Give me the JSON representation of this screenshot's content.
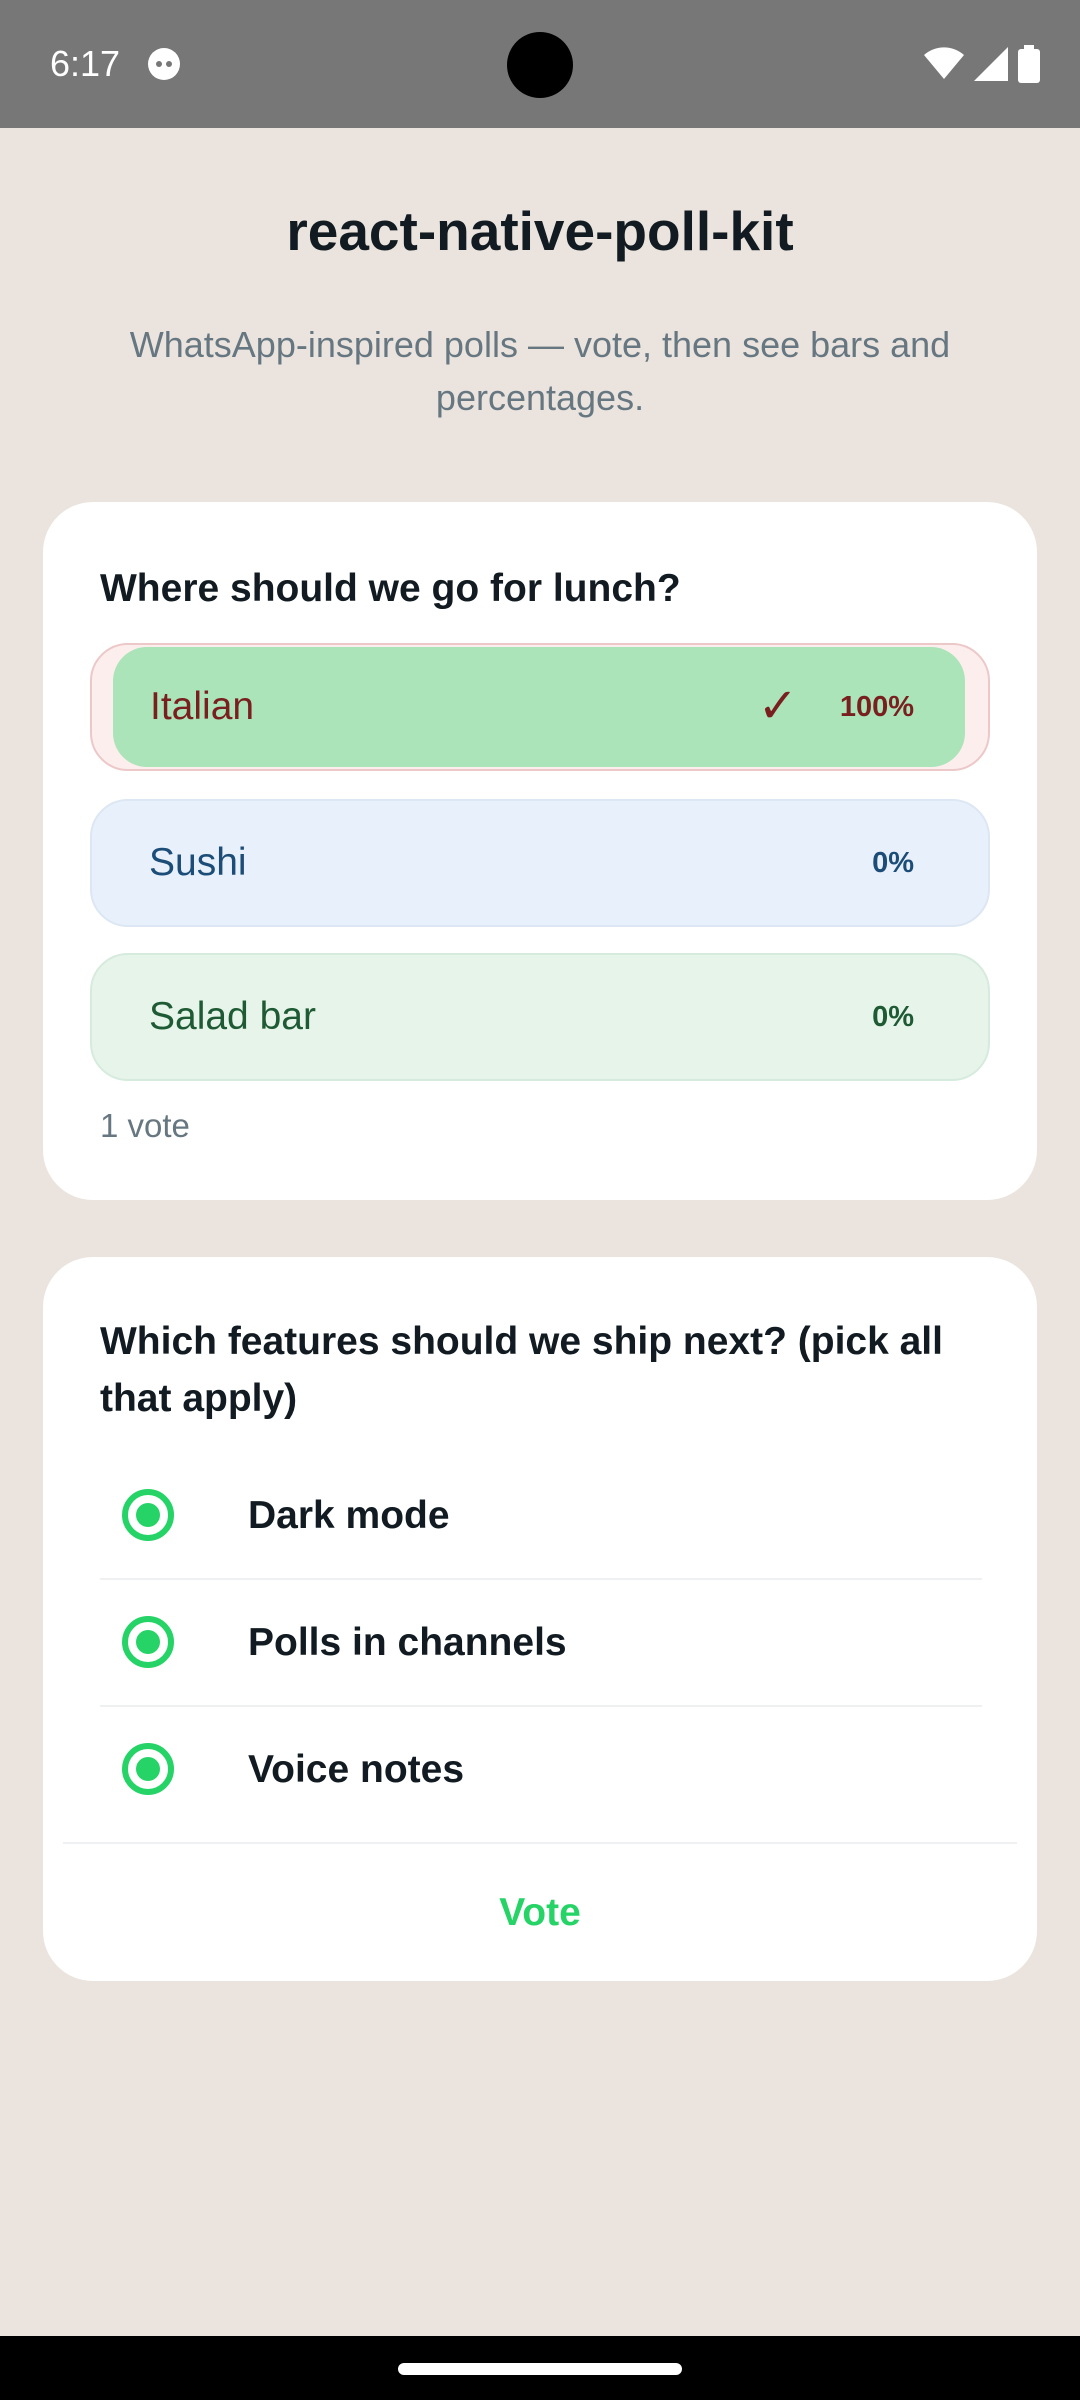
{
  "status_bar": {
    "time": "6:17",
    "icons": [
      "app-notification-icon",
      "wifi-icon",
      "cellular-signal-icon",
      "battery-icon"
    ]
  },
  "header": {
    "title": "react-native-poll-kit",
    "subtitle": "WhatsApp-inspired polls — vote, then see bars and percentages."
  },
  "poll1": {
    "question": "Where should we go for lunch?",
    "options": [
      {
        "label": "Italian",
        "percent": "100%",
        "fill_fraction": 1.0,
        "selected": true,
        "checkmark": "✓"
      },
      {
        "label": "Sushi",
        "percent": "0%",
        "fill_fraction": 0.0,
        "selected": false
      },
      {
        "label": "Salad bar",
        "percent": "0%",
        "fill_fraction": 0.0,
        "selected": false
      }
    ],
    "vote_count": "1 vote"
  },
  "poll2": {
    "question": "Which features should we ship next? (pick all that apply)",
    "options": [
      {
        "label": "Dark mode",
        "checked": true
      },
      {
        "label": "Polls in channels",
        "checked": true
      },
      {
        "label": "Voice notes",
        "checked": true
      }
    ],
    "vote_button": "Vote"
  },
  "colors": {
    "background": "#ebe4de",
    "accent_green": "#25d366",
    "italian_fill": "#aae4b8",
    "italian_text": "#7a1f1f",
    "sushi_text": "#1c4d78",
    "salad_text": "#1e5a33"
  }
}
